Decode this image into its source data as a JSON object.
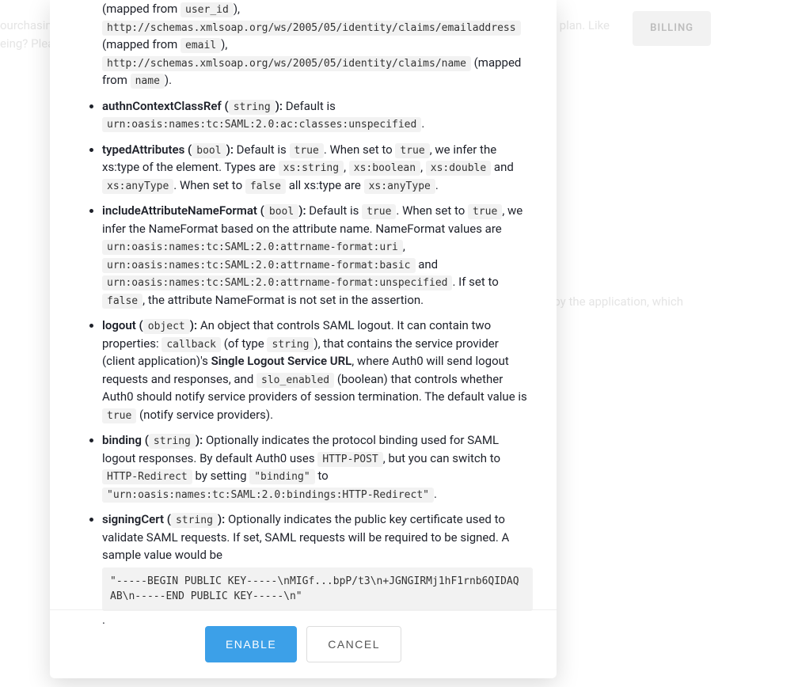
{
  "backdrop": {
    "text1": "ourchasing",
    "text2": "eing? Pleas",
    "text3": "e plan. Like",
    "text4": "d by the application, which",
    "billing": "BILLING"
  },
  "params": {
    "mapped_from_1": "(mapped from ",
    "user_id": "user_id",
    "after_user_id": "), ",
    "claim_email": "http://schemas.xmlsoap.org/ws/2005/05/identity/claims/emailaddress",
    "mapped_from_2": "(mapped from ",
    "email": "email",
    "after_email": "), ",
    "claim_name": "http://schemas.xmlsoap.org/ws/2005/05/identity/claims/name",
    "mapped_from_name": " (mapped from ",
    "name": "name",
    "after_name": ").",
    "authnContextClassRef": {
      "label": "authnContextClassRef (",
      "type": "string",
      "after_type": "):",
      "default": " Default is ",
      "value": "urn:oasis:names:tc:SAML:2.0:ac:classes:unspecified",
      "end": "."
    },
    "typedAttributes": {
      "label": "typedAttributes (",
      "type": "bool",
      "after_type": "):",
      "default": " Default is ",
      "true1": "true",
      "when_set": ". When set to ",
      "true2": "true",
      "infer": ", we infer the xs:type of the element. Types are ",
      "xsstring": "xs:string",
      "c1": ", ",
      "xsboolean": "xs:boolean",
      "c2": ", ",
      "xsdouble": "xs:double",
      "and": " and ",
      "xsanytype": "xs:anyType",
      "when_false": ". When set to ",
      "false": "false",
      "all_types": " all xs:type are ",
      "xsanytype2": "xs:anyType",
      "end": "."
    },
    "includeAttributeNameFormat": {
      "label": "includeAttributeNameFormat (",
      "type": "bool",
      "after_type": "):",
      "default": " Default is ",
      "true1": "true",
      "when_set": ". When set to ",
      "true2": "true",
      "infer": ", we infer the NameFormat based on the attribute name. NameFormat values are ",
      "uri": "urn:oasis:names:tc:SAML:2.0:attrname-format:uri",
      "c1": ", ",
      "basic": "urn:oasis:names:tc:SAML:2.0:attrname-format:basic",
      "and": " and ",
      "unspecified": "urn:oasis:names:tc:SAML:2.0:attrname-format:unspecified",
      "if_set": ". If set to ",
      "false": "false",
      "not_set": ", the attribute NameFormat is not set in the assertion."
    },
    "logout": {
      "label": "logout (",
      "type": "object",
      "after_type": "):",
      "desc": " An object that controls SAML logout. It can contain two properties: ",
      "callback": "callback",
      "of_type": " (of type ",
      "string": "string",
      "that_contains": "), that contains the service provider (client application)'s ",
      "slo_url": "Single Logout Service URL",
      "where": ", where Auth0 will send logout requests and responses, and ",
      "slo_enabled": "slo_enabled",
      "boolean": " (boolean) that controls whether Auth0 should notify service providers of session termination. The default value is ",
      "true": "true",
      "notify": " (notify service providers)."
    },
    "binding": {
      "label": "binding (",
      "type": "string",
      "after_type": "):",
      "desc": " Optionally indicates the protocol binding used for SAML logout responses. By default Auth0 uses ",
      "http_post": "HTTP-POST",
      "but": ", but you can switch to ",
      "http_redirect": "HTTP-Redirect",
      "by_setting": " by setting ",
      "binding_key": "\"binding\"",
      "to": " to ",
      "binding_val": "\"urn:oasis:names:tc:SAML:2.0:bindings:HTTP-Redirect\"",
      "end": "."
    },
    "signingCert": {
      "label": "signingCert (",
      "type": "string",
      "after_type": "):",
      "desc": " Optionally indicates the public key certificate used to validate SAML requests. If set, SAML requests will be required to be signed. A sample value would be",
      "cert": "\"-----BEGIN PUBLIC KEY-----\\nMIGf...bpP/t3\\n+JGNGIRMj1hF1rnb6QIDAQAB\\n-----END PUBLIC KEY-----\\n\"",
      "end": "."
    }
  },
  "footer": {
    "enable": "ENABLE",
    "cancel": "CANCEL"
  }
}
